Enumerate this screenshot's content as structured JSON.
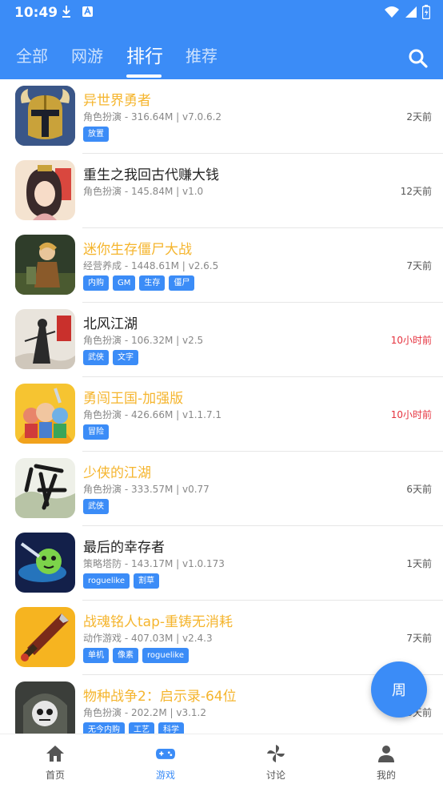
{
  "status": {
    "time": "10:49"
  },
  "tabs": [
    {
      "label": "全部"
    },
    {
      "label": "网游"
    },
    {
      "label": "排行",
      "active": true
    },
    {
      "label": "推荐"
    }
  ],
  "colors": {
    "primary": "#3b8cf7",
    "hot_title": "#f5b52e",
    "recent": "#e5323e"
  },
  "games": [
    {
      "title": "异世界勇者",
      "meta": "角色扮演 - 316.64M | v7.0.6.2",
      "tags": [
        "放置"
      ],
      "when": "2天前",
      "hot": true,
      "icon": "knight-helmet-icon"
    },
    {
      "title": "重生之我回古代赚大钱",
      "meta": "角色扮演 - 145.84M | v1.0",
      "tags": [],
      "when": "12天前",
      "hot": false,
      "icon": "ancient-lady-icon"
    },
    {
      "title": "迷你生存僵尸大战",
      "meta": "经营养成 - 1448.61M | v2.6.5",
      "tags": [
        "内购",
        "GM",
        "生存",
        "僵尸"
      ],
      "when": "7天前",
      "hot": true,
      "icon": "survivor-icon"
    },
    {
      "title": "北风江湖",
      "meta": "角色扮演 - 106.32M | v2.5",
      "tags": [
        "武侠",
        "文字"
      ],
      "when": "10小时前",
      "hot": false,
      "recent": true,
      "icon": "swordsman-ink-icon"
    },
    {
      "title": "勇闯王国-加强版",
      "meta": "角色扮演 - 426.66M | v1.1.7.1",
      "tags": [
        "冒险"
      ],
      "when": "10小时前",
      "hot": true,
      "recent": true,
      "icon": "heroes-party-icon"
    },
    {
      "title": "少侠的江湖",
      "meta": "角色扮演 - 333.57M | v0.77",
      "tags": [
        "武侠"
      ],
      "when": "6天前",
      "hot": true,
      "icon": "calligraphy-xia-icon"
    },
    {
      "title": "最后的幸存者",
      "meta": "策略塔防 - 143.17M | v1.0.173",
      "tags": [
        "roguelike",
        "割草"
      ],
      "when": "1天前",
      "hot": false,
      "icon": "green-blob-icon"
    },
    {
      "title": "战魂铭人tap-重铸无消耗",
      "meta": "动作游戏 - 407.03M | v2.4.3",
      "tags": [
        "单机",
        "像素",
        "roguelike"
      ],
      "when": "7天前",
      "hot": true,
      "icon": "pixel-sword-icon"
    },
    {
      "title": "物种战争2：启示录-64位",
      "meta": "角色扮演 - 202.2M | v3.1.2",
      "tags": [
        "无今内购",
        "工艺",
        "科学"
      ],
      "when": "3天前",
      "hot": true,
      "icon": "skull-soldier-icon"
    }
  ],
  "fab": {
    "label": "周"
  },
  "bottom_nav": [
    {
      "label": "首页",
      "icon": "home-icon"
    },
    {
      "label": "游戏",
      "icon": "gamepad-icon",
      "active": true
    },
    {
      "label": "讨论",
      "icon": "pinwheel-icon"
    },
    {
      "label": "我的",
      "icon": "user-icon"
    }
  ]
}
